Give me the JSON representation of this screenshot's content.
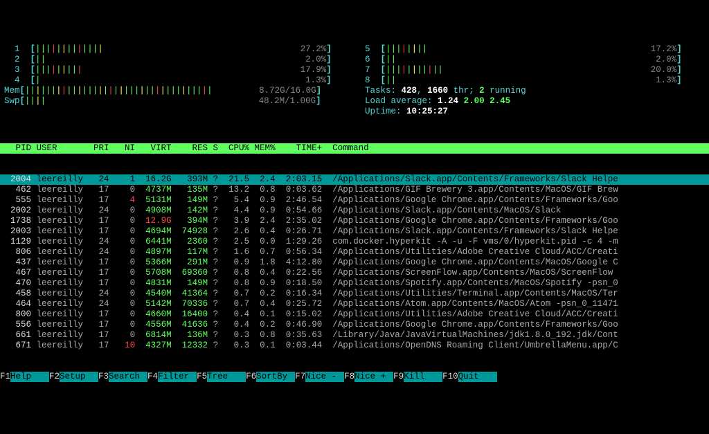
{
  "cpu_meters": [
    {
      "id": "1",
      "bars": "|||||||||||||",
      "pct": "27.2%"
    },
    {
      "id": "2",
      "bars": "||",
      "pct": "2.0%"
    },
    {
      "id": "3",
      "bars": "|||||||||",
      "pct": "17.9%"
    },
    {
      "id": "4",
      "bars": "|",
      "pct": "1.3%"
    },
    {
      "id": "5",
      "bars": "||||||||",
      "pct": "17.2%"
    },
    {
      "id": "6",
      "bars": "||",
      "pct": "2.0%"
    },
    {
      "id": "7",
      "bars": "|||||||||||",
      "pct": "20.0%"
    },
    {
      "id": "8",
      "bars": "||",
      "pct": "1.3%"
    }
  ],
  "mem": {
    "label": "Mem",
    "bars": "||||||||||||||||||||||||||||||||||||",
    "val": "8.72G/16.0G"
  },
  "swp": {
    "label": "Swp",
    "bars": "||||",
    "val": "48.2M/1.00G"
  },
  "tasks": {
    "label": "Tasks: ",
    "total": "428",
    "sep1": ", ",
    "thr": "1660",
    "thr_lbl": " thr; ",
    "running": "2",
    "running_lbl": " running"
  },
  "load": {
    "label": "Load average: ",
    "l1": "1.24",
    "l2": "2.00",
    "l3": "2.45"
  },
  "uptime": {
    "label": "Uptime: ",
    "val": "10:25:27"
  },
  "headers": {
    "pid": "PID",
    "user": "USER",
    "pri": "PRI",
    "ni": "NI",
    "virt": "VIRT",
    "res": "RES",
    "s": "S",
    "cpu": "CPU%",
    "mem": "MEM%",
    "time": "TIME+",
    "cmd": "Command"
  },
  "procs": [
    {
      "pid": "2004",
      "user": "leereilly",
      "pri": "24",
      "ni": "1",
      "virt": "16.2G",
      "res": "393M",
      "s": "?",
      "cpu": "21.5",
      "mem": "2.4",
      "time": "2:03.15",
      "cmd": "/Applications/Slack.app/Contents/Frameworks/Slack Helpe",
      "sel": true
    },
    {
      "pid": "462",
      "user": "leereilly",
      "pri": "17",
      "ni": "0",
      "virt": "4737M",
      "res": "135M",
      "s": "?",
      "cpu": "13.2",
      "mem": "0.8",
      "time": "0:03.62",
      "cmd": "/Applications/GIF Brewery 3.app/Contents/MacOS/GIF Brew"
    },
    {
      "pid": "555",
      "user": "leereilly",
      "pri": "17",
      "ni": "4",
      "virt": "5131M",
      "res": "149M",
      "s": "?",
      "cpu": "5.4",
      "mem": "0.9",
      "time": "2:46.54",
      "cmd": "/Applications/Google Chrome.app/Contents/Frameworks/Goo"
    },
    {
      "pid": "2002",
      "user": "leereilly",
      "pri": "24",
      "ni": "0",
      "virt": "4908M",
      "res": "142M",
      "s": "?",
      "cpu": "4.4",
      "mem": "0.9",
      "time": "0:54.66",
      "cmd": "/Applications/Slack.app/Contents/MacOS/Slack"
    },
    {
      "pid": "1738",
      "user": "leereilly",
      "pri": "17",
      "ni": "0",
      "virt": "12.9G",
      "res": "394M",
      "s": "?",
      "cpu": "3.9",
      "mem": "2.4",
      "time": "2:35.02",
      "cmd": "/Applications/Google Chrome.app/Contents/Frameworks/Goo",
      "virt_red": true
    },
    {
      "pid": "2003",
      "user": "leereilly",
      "pri": "17",
      "ni": "0",
      "virt": "4694M",
      "res": "74928",
      "s": "?",
      "cpu": "2.6",
      "mem": "0.4",
      "time": "0:26.71",
      "cmd": "/Applications/Slack.app/Contents/Frameworks/Slack Helpe"
    },
    {
      "pid": "1129",
      "user": "leereilly",
      "pri": "24",
      "ni": "0",
      "virt": "6441M",
      "res": "2360",
      "s": "?",
      "cpu": "2.5",
      "mem": "0.0",
      "time": "1:29.26",
      "cmd": "com.docker.hyperkit -A -u -F vms/0/hyperkit.pid -c 4 -m"
    },
    {
      "pid": "806",
      "user": "leereilly",
      "pri": "24",
      "ni": "0",
      "virt": "4897M",
      "res": "117M",
      "s": "?",
      "cpu": "1.6",
      "mem": "0.7",
      "time": "0:56.34",
      "cmd": "/Applications/Utilities/Adobe Creative Cloud/ACC/Creati"
    },
    {
      "pid": "437",
      "user": "leereilly",
      "pri": "17",
      "ni": "0",
      "virt": "5366M",
      "res": "291M",
      "s": "?",
      "cpu": "0.9",
      "mem": "1.8",
      "time": "4:12.80",
      "cmd": "/Applications/Google Chrome.app/Contents/MacOS/Google C"
    },
    {
      "pid": "467",
      "user": "leereilly",
      "pri": "17",
      "ni": "0",
      "virt": "5708M",
      "res": "69360",
      "s": "?",
      "cpu": "0.8",
      "mem": "0.4",
      "time": "0:22.56",
      "cmd": "/Applications/ScreenFlow.app/Contents/MacOS/ScreenFlow"
    },
    {
      "pid": "470",
      "user": "leereilly",
      "pri": "17",
      "ni": "0",
      "virt": "4831M",
      "res": "149M",
      "s": "?",
      "cpu": "0.8",
      "mem": "0.9",
      "time": "0:18.50",
      "cmd": "/Applications/Spotify.app/Contents/MacOS/Spotify -psn_0"
    },
    {
      "pid": "458",
      "user": "leereilly",
      "pri": "24",
      "ni": "0",
      "virt": "4540M",
      "res": "41364",
      "s": "?",
      "cpu": "0.7",
      "mem": "0.2",
      "time": "0:16.34",
      "cmd": "/Applications/Utilities/Terminal.app/Contents/MacOS/Ter"
    },
    {
      "pid": "464",
      "user": "leereilly",
      "pri": "24",
      "ni": "0",
      "virt": "5142M",
      "res": "70336",
      "s": "?",
      "cpu": "0.7",
      "mem": "0.4",
      "time": "0:25.72",
      "cmd": "/Applications/Atom.app/Contents/MacOS/Atom -psn_0_11471"
    },
    {
      "pid": "800",
      "user": "leereilly",
      "pri": "17",
      "ni": "0",
      "virt": "4660M",
      "res": "16400",
      "s": "?",
      "cpu": "0.4",
      "mem": "0.1",
      "time": "0:15.02",
      "cmd": "/Applications/Utilities/Adobe Creative Cloud/ACC/Creati"
    },
    {
      "pid": "556",
      "user": "leereilly",
      "pri": "17",
      "ni": "0",
      "virt": "4556M",
      "res": "41636",
      "s": "?",
      "cpu": "0.4",
      "mem": "0.2",
      "time": "0:46.90",
      "cmd": "/Applications/Google Chrome.app/Contents/Frameworks/Goo"
    },
    {
      "pid": "661",
      "user": "leereilly",
      "pri": "17",
      "ni": "0",
      "virt": "6814M",
      "res": "136M",
      "s": "?",
      "cpu": "0.3",
      "mem": "0.8",
      "time": "0:35.63",
      "cmd": "/Library/Java/JavaVirtualMachines/jdk1.8.0_192.jdk/Cont"
    },
    {
      "pid": "671",
      "user": "leereilly",
      "pri": "17",
      "ni": "10",
      "virt": "4327M",
      "res": "12332",
      "s": "?",
      "cpu": "0.3",
      "mem": "0.1",
      "time": "0:03.44",
      "cmd": "/Applications/OpenDNS Roaming Client/UmbrellaMenu.app/C"
    }
  ],
  "fn": [
    {
      "k": "F1",
      "l": "Help"
    },
    {
      "k": "F2",
      "l": "Setup"
    },
    {
      "k": "F3",
      "l": "Search"
    },
    {
      "k": "F4",
      "l": "Filter"
    },
    {
      "k": "F5",
      "l": "Tree"
    },
    {
      "k": "F6",
      "l": "SortBy"
    },
    {
      "k": "F7",
      "l": "Nice -"
    },
    {
      "k": "F8",
      "l": "Nice +"
    },
    {
      "k": "F9",
      "l": "Kill"
    },
    {
      "k": "F10",
      "l": "Quit"
    }
  ]
}
